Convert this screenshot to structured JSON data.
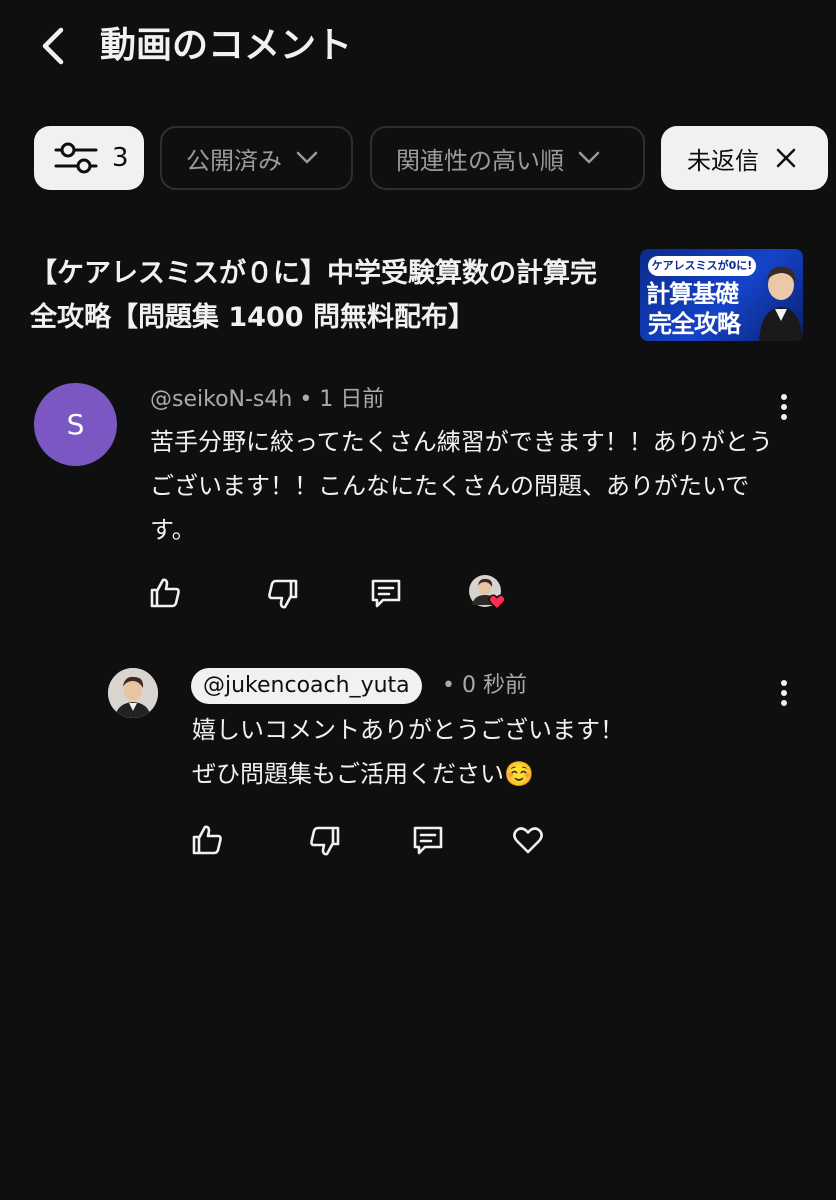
{
  "header": {
    "title": "動画のコメント",
    "back_icon": "chevron-left-icon"
  },
  "filters": {
    "filter_count": "3",
    "published_label": "公開済み",
    "sort_label": "関連性の高い順",
    "unreplied_label": "未返信"
  },
  "video": {
    "title": "【ケアレスミスが０に】中学受験算数の計算完全攻略【問題集 1400 問無料配布】",
    "thumbnail": {
      "banner": "ケアレスミスが0に!",
      "line1": "計算基礎",
      "line2": "完全攻略"
    }
  },
  "comment": {
    "avatar_letter": "S",
    "author": "@seikoN-s4h",
    "separator": "•",
    "time": "1 日前",
    "text": "苦手分野に絞ってたくさん練習ができます！！ありがとうございます！！こんなにたくさんの問題、ありがたいです。"
  },
  "reply": {
    "author": "@jukencoach_yuta",
    "separator": "•",
    "time": "0 秒前",
    "line1": "嬉しいコメントありがとうございます！",
    "line2": "ぜひ問題集もご活用ください☺️"
  },
  "colors": {
    "background": "#0f0f0f",
    "chip_light": "#f1f1f1",
    "avatar_purple": "#7b57c4",
    "heart_red": "#ff2d55"
  }
}
